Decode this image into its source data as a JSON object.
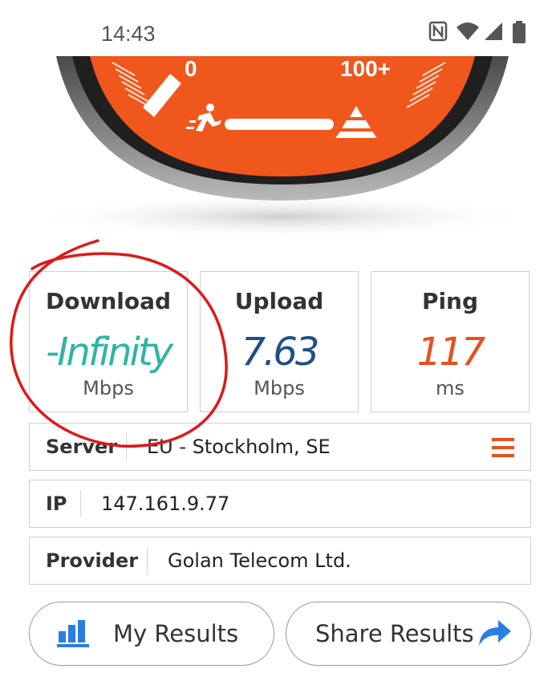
{
  "status_bar": {
    "time": "14:43",
    "icons": [
      "nfc-icon",
      "wifi-icon",
      "cellular-signal-icon",
      "battery-icon"
    ]
  },
  "gauge": {
    "min_label": "0",
    "max_label": "100+",
    "colors": {
      "face": "#f0571c",
      "bezel": "#2a2a2a",
      "rim": "#8a8a8a"
    }
  },
  "metrics": {
    "download": {
      "title": "Download",
      "value": "-Infinity",
      "unit": "Mbps",
      "color": "#2fb5a3"
    },
    "upload": {
      "title": "Upload",
      "value": "7.63",
      "unit": "Mbps",
      "color": "#1e4f86"
    },
    "ping": {
      "title": "Ping",
      "value": "117",
      "unit": "ms",
      "color": "#e8501a"
    }
  },
  "info": {
    "server": {
      "label": "Server",
      "value": "EU - Stockholm, SE"
    },
    "ip": {
      "label": "IP",
      "value": "147.161.9.77"
    },
    "provider": {
      "label": "Provider",
      "value": "Golan Telecom Ltd."
    }
  },
  "buttons": {
    "my_results": "My Results",
    "share_results": "Share Results"
  },
  "accent_colors": {
    "orange": "#e8501a",
    "blue": "#2a7de1",
    "annotation_red": "#e01818"
  }
}
